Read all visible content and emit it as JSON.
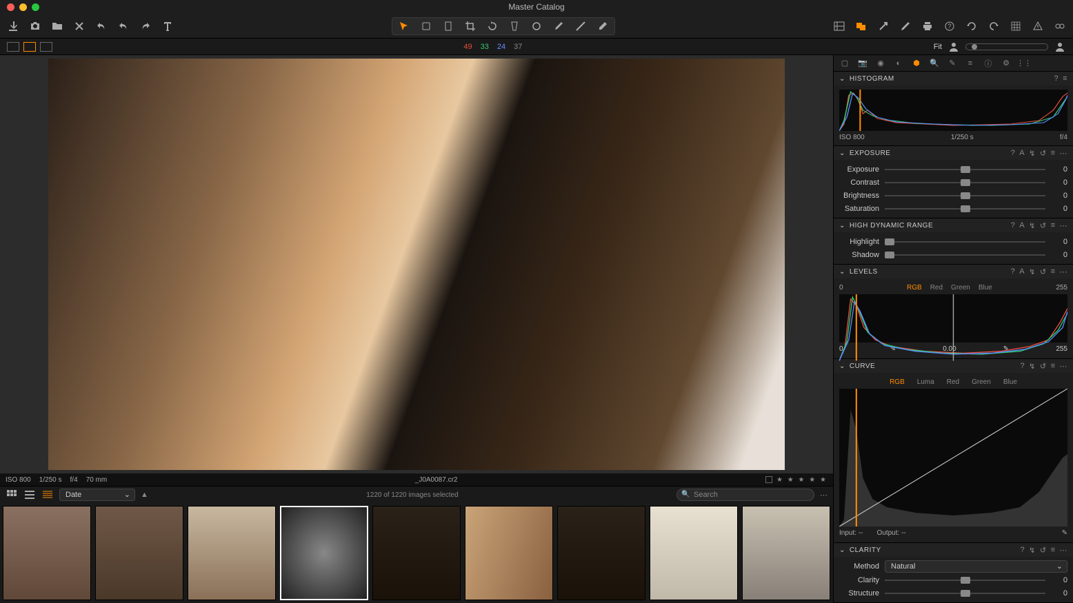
{
  "window": {
    "title": "Master Catalog"
  },
  "counts": {
    "red": "49",
    "green": "33",
    "blue": "24",
    "gray": "37"
  },
  "fit_label": "Fit",
  "image_info": {
    "iso": "ISO 800",
    "shutter": "1/250 s",
    "aperture": "f/4",
    "focal": "70 mm",
    "filename": "_J0A0087.cr2",
    "stars": "★ ★ ★ ★ ★"
  },
  "browser": {
    "sort": "Date",
    "status": "1220 of 1220 images selected",
    "search_placeholder": "Search"
  },
  "histogram": {
    "title": "HISTOGRAM",
    "iso": "ISO 800",
    "shutter": "1/250 s",
    "aperture": "f/4"
  },
  "exposure": {
    "title": "EXPOSURE",
    "rows": [
      {
        "label": "Exposure",
        "value": "0"
      },
      {
        "label": "Contrast",
        "value": "0"
      },
      {
        "label": "Brightness",
        "value": "0"
      },
      {
        "label": "Saturation",
        "value": "0"
      }
    ]
  },
  "hdr": {
    "title": "HIGH DYNAMIC RANGE",
    "rows": [
      {
        "label": "Highlight",
        "value": "0"
      },
      {
        "label": "Shadow",
        "value": "0"
      }
    ]
  },
  "levels": {
    "title": "LEVELS",
    "low": "0",
    "high": "255",
    "tabs": [
      "RGB",
      "Red",
      "Green",
      "Blue"
    ],
    "ctrl_low": "0",
    "ctrl_mid": "0.00",
    "ctrl_high": "255"
  },
  "curve": {
    "title": "CURVE",
    "tabs": [
      "RGB",
      "Luma",
      "Red",
      "Green",
      "Blue"
    ],
    "input_label": "Input:",
    "output_label": "Output:",
    "input_val": "--",
    "output_val": "--"
  },
  "clarity": {
    "title": "CLARITY",
    "method_label": "Method",
    "method": "Natural",
    "rows": [
      {
        "label": "Clarity",
        "value": "0"
      },
      {
        "label": "Structure",
        "value": "0"
      }
    ]
  }
}
